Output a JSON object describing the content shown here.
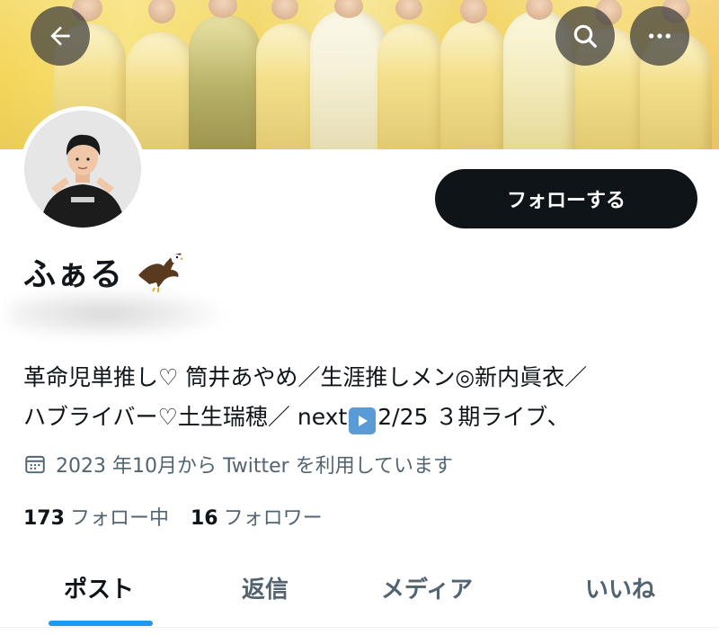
{
  "header": {
    "back_icon": "arrow-left-icon",
    "search_icon": "search-icon",
    "more_icon": "more-horizontal-icon"
  },
  "profile": {
    "display_name": "ふぁる",
    "name_emoji": "eagle-emoji",
    "follow_label": "フォローする",
    "bio_line1": "革命児単推し♡ 筒井あやめ／生涯推しメン◎新内眞衣／",
    "bio_line2_before": "ハブライバー♡土生瑞穂／ next",
    "bio_line2_after": "2/25 ３期ライブ、",
    "joined": "2023 年10月から Twitter を利用しています",
    "following_count": "173",
    "following_label": "フォロー中",
    "followers_count": "16",
    "followers_label": "フォロワー"
  },
  "tabs": [
    {
      "label": "ポスト",
      "active": true
    },
    {
      "label": "返信",
      "active": false
    },
    {
      "label": "メディア",
      "active": false
    },
    {
      "label": "いいね",
      "active": false
    }
  ],
  "colors": {
    "accent": "#1d9bf0",
    "primary_text": "#0f1419",
    "secondary_text": "#536471",
    "follow_button_bg": "#0f1419"
  }
}
